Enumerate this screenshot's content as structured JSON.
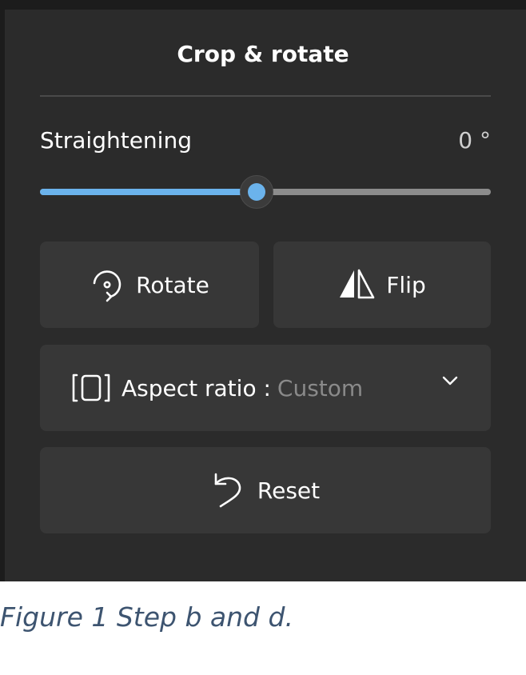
{
  "panel": {
    "title": "Crop & rotate"
  },
  "straightening": {
    "label": "Straightening",
    "value": "0 °",
    "slider_fraction": 0.5
  },
  "buttons": {
    "rotate_label": "Rotate",
    "flip_label": "Flip",
    "aspect_label": "Aspect ratio :",
    "aspect_value": "Custom",
    "reset_label": "Reset"
  },
  "icons": {
    "rotate": "rotate-icon",
    "flip": "flip-icon",
    "aspect": "aspect-ratio-icon",
    "chevron": "chevron-down-icon",
    "reset": "undo-icon"
  },
  "colors": {
    "accent": "#6bb3ec",
    "panel_bg": "#2b2b2b",
    "button_bg": "#373737"
  },
  "caption": "Figure 1 Step b and d."
}
